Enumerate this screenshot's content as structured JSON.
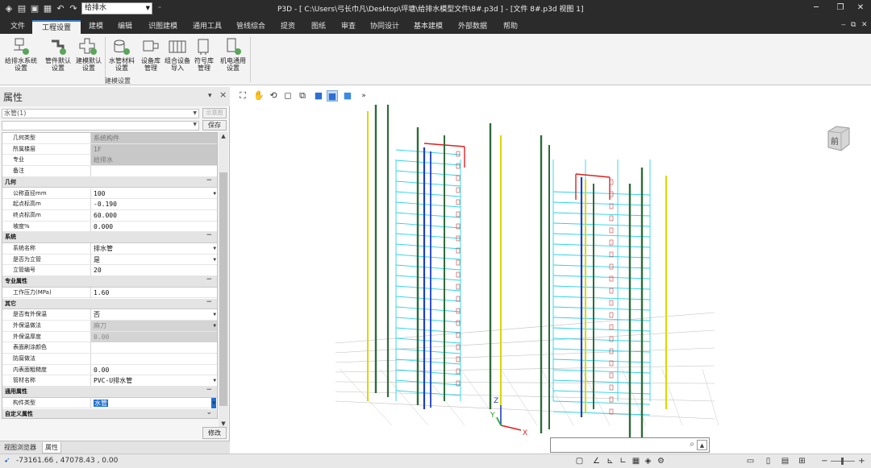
{
  "window": {
    "title": "P3D - [ C:\\Users\\弓长巾凡\\Desktop\\坪塘\\给排水模型文件\\8#.p3d ] - [文件 8#.p3d 视图 1]",
    "quick_combo": "给排水"
  },
  "menu": {
    "tabs": [
      "文件",
      "工程设置",
      "建模",
      "编辑",
      "识图建模",
      "通用工具",
      "管线综合",
      "提资",
      "图纸",
      "审查",
      "协同设计",
      "基本建模",
      "外部数据",
      "帮助"
    ],
    "active": "工程设置"
  },
  "ribbon": {
    "buttons": [
      {
        "label": "给排水系统\n设置",
        "icon": "drainage-system-icon"
      },
      {
        "label": "管件默认\n设置",
        "icon": "fitting-default-icon"
      },
      {
        "label": "建模默认\n设置",
        "icon": "modeling-default-icon"
      },
      {
        "label": "水管材料\n设置",
        "icon": "pipe-material-icon"
      },
      {
        "label": "设备库\n管理",
        "icon": "equipment-library-icon"
      },
      {
        "label": "组合设备\n导入",
        "icon": "combo-equipment-icon"
      },
      {
        "label": "符号库\n管理",
        "icon": "symbol-library-icon"
      },
      {
        "label": "机电通用\n设置",
        "icon": "mep-general-icon"
      }
    ],
    "group_label": "建模设置"
  },
  "properties": {
    "title": "属性",
    "pin": "▾",
    "close": "×",
    "type_combo": "水管(1)",
    "show_image_btn": "示意图",
    "save_btn": "保存",
    "modify_btn": "修改",
    "rows": [
      {
        "kind": "prop",
        "label": "几何类型",
        "value": "系统构件",
        "style": "gray"
      },
      {
        "kind": "prop",
        "label": "所属楼层",
        "value": "1F",
        "style": "gray"
      },
      {
        "kind": "prop",
        "label": "专业",
        "value": "给排水",
        "style": "gray"
      },
      {
        "kind": "prop",
        "label": "备注",
        "value": ""
      },
      {
        "kind": "section",
        "label": "几何"
      },
      {
        "kind": "prop",
        "label": "公称直径mm",
        "value": "100",
        "dropdown": true
      },
      {
        "kind": "prop",
        "label": "起点标高m",
        "value": "-0.190"
      },
      {
        "kind": "prop",
        "label": "终点标高m",
        "value": "60.000"
      },
      {
        "kind": "prop",
        "label": "坡度%",
        "value": "0.000"
      },
      {
        "kind": "section",
        "label": "系统"
      },
      {
        "kind": "prop",
        "label": "系统名称",
        "value": "排水管",
        "dropdown": true
      },
      {
        "kind": "prop",
        "label": "是否为立管",
        "value": "是",
        "dropdown": true
      },
      {
        "kind": "prop",
        "label": "立管编号",
        "value": "20"
      },
      {
        "kind": "section",
        "label": "专业属性"
      },
      {
        "kind": "prop",
        "label": "工作压力(MPa)",
        "value": "1.60"
      },
      {
        "kind": "section",
        "label": "其它"
      },
      {
        "kind": "prop",
        "label": "是否有外保温",
        "value": "否",
        "dropdown": true
      },
      {
        "kind": "prop",
        "label": "外保温做法",
        "value": "麻刀",
        "style": "grayv",
        "dropdown": true
      },
      {
        "kind": "prop",
        "label": "外保温厚度",
        "value": "0.00",
        "style": "grayv"
      },
      {
        "kind": "prop",
        "label": "表面刷涂颜色",
        "value": ""
      },
      {
        "kind": "prop",
        "label": "防腐做法",
        "value": ""
      },
      {
        "kind": "prop",
        "label": "内表面粗糙度",
        "value": "0.00"
      },
      {
        "kind": "prop",
        "label": "管材名称",
        "value": "PVC-U排水管",
        "dropdown": true
      },
      {
        "kind": "section",
        "label": "通用属性"
      },
      {
        "kind": "prop",
        "label": "构件类型",
        "value": "水管",
        "style": "sel",
        "dropdown": true
      },
      {
        "kind": "section",
        "label": "自定义属性",
        "collapsed": true
      }
    ]
  },
  "bottom_tabs": [
    "视图浏览器",
    "属性"
  ],
  "status": {
    "coords": "-73161.66 , 47078.43 , 0.00"
  },
  "viewcube_label": "前",
  "axis_labels": {
    "z": "Z",
    "x": "X",
    "y": "Y"
  },
  "colors": {
    "accent": "#3b7fd1",
    "pipe_green": "#2f6b3a",
    "pipe_yellow": "#d8d800",
    "pipe_blue": "#1e3fc4",
    "pipe_cyan": "#2ad3e6",
    "pipe_red": "#e02020"
  }
}
